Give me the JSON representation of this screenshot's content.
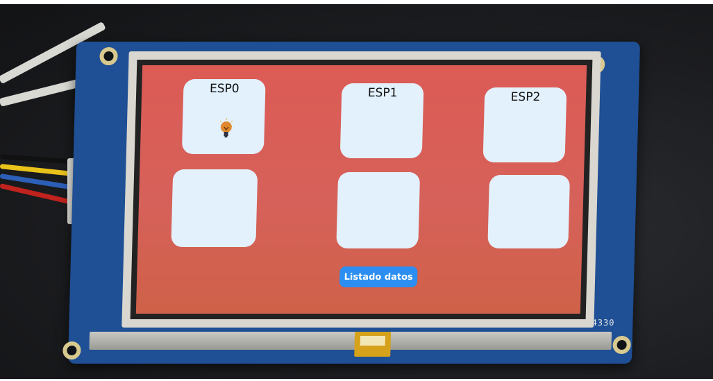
{
  "screen": {
    "tiles": [
      {
        "label": "ESP0",
        "icon": "lightbulb-icon"
      },
      {
        "label": "ESP1",
        "icon": ""
      },
      {
        "label": "ESP2",
        "icon": ""
      },
      {
        "label": "",
        "icon": ""
      },
      {
        "label": "",
        "icon": ""
      },
      {
        "label": "",
        "icon": ""
      }
    ],
    "list_button_label": "Listado datos"
  },
  "board": {
    "model_mark": "4330"
  },
  "colors": {
    "screen_background": "#dc5b55",
    "tile_background": "#e3f1fd",
    "button_background": "#2b8ef0",
    "pcb": "#1f4f94"
  }
}
